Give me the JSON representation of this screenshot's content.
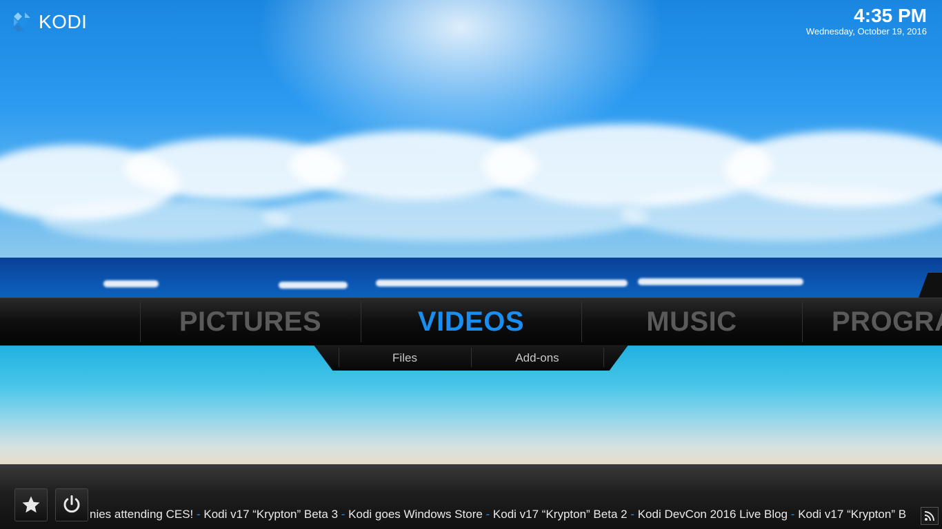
{
  "app": {
    "logo_text": "KODI"
  },
  "clock": {
    "time": "4:35 PM",
    "date": "Wednesday, October 19, 2016"
  },
  "main_menu": {
    "items": [
      {
        "label": ""
      },
      {
        "label": "PICTURES"
      },
      {
        "label": "VIDEOS",
        "active": true
      },
      {
        "label": "MUSIC"
      },
      {
        "label": "PROGRA"
      }
    ],
    "accent_color": "#1a8ef0"
  },
  "submenu": {
    "items": [
      {
        "label": "Files"
      },
      {
        "label": "Add-ons"
      }
    ]
  },
  "footer": {
    "favourites_icon": "star-icon",
    "power_icon": "power-icon",
    "rss_icon": "rss-icon",
    "ticker": [
      "nies attending CES!",
      "Kodi v17 “Krypton” Beta 3",
      "Kodi goes Windows Store",
      "Kodi v17 “Krypton” Beta 2",
      "Kodi DevCon 2016 Live Blog",
      "Kodi v17 “Krypton” B"
    ],
    "ticker_separator": " - "
  }
}
